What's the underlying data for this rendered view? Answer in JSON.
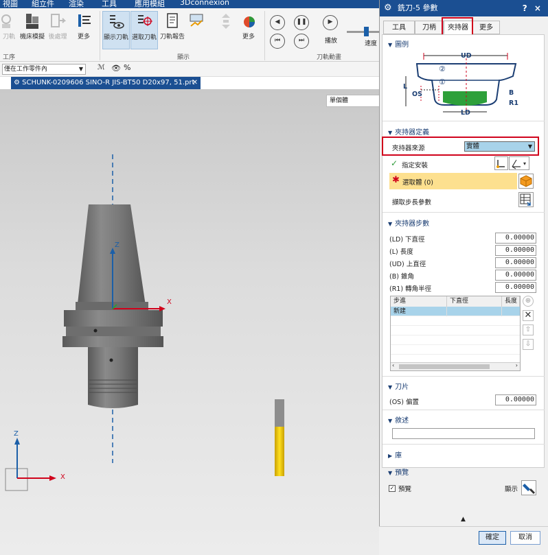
{
  "ribbon": {
    "tabs": [
      "視圖",
      "組立件",
      "渲染",
      "工具",
      "應用模組",
      "3Dconnexion"
    ],
    "buttons": {
      "toolpath": "刀軌",
      "machine_sim": "機床模擬",
      "post": "後處理",
      "more1": "更多",
      "show_tool": "顯示刀軌",
      "pick_tool": "選取刀軌",
      "tool_report": "刀軌報告",
      "more2": "更多",
      "play": "播放",
      "speed": "速度"
    },
    "groups": {
      "process": "工序",
      "display": "顯示",
      "animation": "刀軌動畫"
    }
  },
  "toolbar2": {
    "selection_scope": "僅在工作零件內"
  },
  "document_tab": {
    "title": "SCHUNK-0209606 SINO-R JIS-BT50 D20x97, 51.prt"
  },
  "viewport": {
    "view_combo": "單個體",
    "axes": {
      "x": "X",
      "y": "Y",
      "z": "Z"
    }
  },
  "dialog": {
    "title": "銑刀-5 參數",
    "controls": "? ×",
    "tabs": [
      "工具",
      "刀柄",
      "夾持器",
      "更多"
    ],
    "active_tab": "夾持器",
    "sections": {
      "diagram": "圖例",
      "holder_def": "夾持器定義",
      "holder_steps": "夾持器步數",
      "insert": "刀片",
      "description": "敘述",
      "library": "庫",
      "preview": "預覽"
    },
    "diagram_labels": {
      "ud": "UD",
      "ld": "LD",
      "l": "L",
      "os": "OS",
      "b": "B",
      "r1": "R1",
      "n1": "①",
      "n2": "②"
    },
    "holder_source_label": "夾持器來源",
    "holder_source_value": "實體",
    "specify_mount": "指定安裝",
    "select_body": "選取體 (0)",
    "extract_params": "擷取步長參數",
    "params": [
      {
        "label": "(LD) 下直徑",
        "value": "0.00000"
      },
      {
        "label": "(L) 長度",
        "value": "0.00000"
      },
      {
        "label": "(UD) 上直徑",
        "value": "0.00000"
      },
      {
        "label": "(B) 錐角",
        "value": "0.00000"
      },
      {
        "label": "(R1) 轉角半徑",
        "value": "0.00000"
      }
    ],
    "step_table": {
      "headers": [
        "步進",
        "下直徑",
        "長度"
      ],
      "rows": [
        [
          "新建",
          "",
          ""
        ]
      ]
    },
    "offset_label": "(OS) 偏置",
    "offset_value": "0.00000",
    "preview_check": "預覽",
    "show_label": "顯示",
    "ok": "確定",
    "cancel": "取消"
  }
}
